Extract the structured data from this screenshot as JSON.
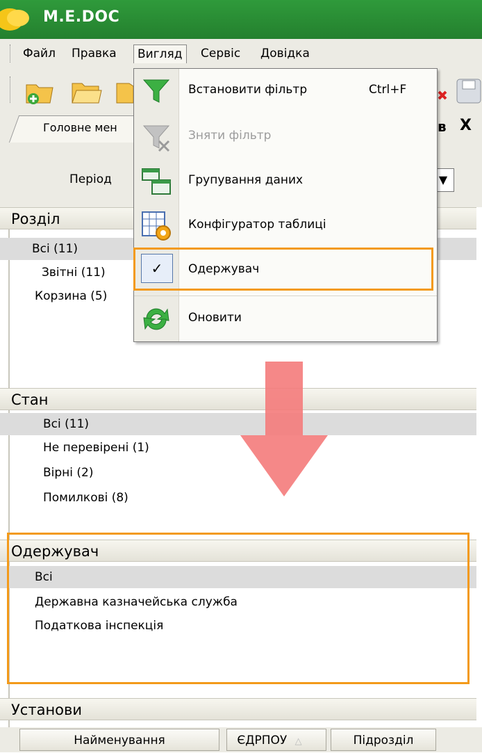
{
  "app": {
    "title": "M.E.DOC"
  },
  "menu": {
    "items": [
      "Файл",
      "Правка",
      "Вигляд",
      "Сервіс",
      "Довідка"
    ]
  },
  "tabs": {
    "main_tab": "Головне мен",
    "right_fragment": "в",
    "close_glyph": "X"
  },
  "period": {
    "label": "Період",
    "dropdown_glyph": "▼"
  },
  "sections": {
    "rozdil": {
      "title": "Розділ",
      "items": [
        "Всі (11)",
        "Звітні (11)",
        "Корзина (5)"
      ]
    },
    "stan": {
      "title": "Стан",
      "items": [
        "Всі (11)",
        "Не перевірені (1)",
        "Вірні (2)",
        "Помилкові (8)"
      ]
    },
    "oderzhuvach": {
      "title": "Одержувач",
      "items": [
        "Всі",
        "Державна казначейська служба",
        "Податкова інспекція"
      ]
    },
    "ustanovy": {
      "title": "Установи",
      "columns": [
        "Найменування",
        "ЄДРПОУ",
        "Підрозділ"
      ],
      "sort_glyph": "△"
    }
  },
  "dropdown": {
    "items": [
      {
        "label": "Встановити фільтр",
        "shortcut": "Ctrl+F",
        "icon": "funnel-icon",
        "disabled": false
      },
      {
        "label": "Зняти фільтр",
        "shortcut": "",
        "icon": "remove-filter-icon",
        "disabled": true
      },
      {
        "label": "Групування даних",
        "shortcut": "",
        "icon": "group-data-icon",
        "disabled": false
      },
      {
        "label": "Конфігуратор таблиці",
        "shortcut": "",
        "icon": "table-config-icon",
        "disabled": false
      },
      {
        "label": "Одержувач",
        "shortcut": "",
        "icon": "checkmark-icon",
        "checked": true,
        "disabled": false
      },
      {
        "label": "Оновити",
        "shortcut": "",
        "icon": "refresh-icon",
        "disabled": false
      }
    ],
    "check_glyph": "✓"
  },
  "colors": {
    "title_green": "#24802e",
    "highlight_orange": "#f39a1a",
    "arrow_red": "#f47b7b"
  }
}
